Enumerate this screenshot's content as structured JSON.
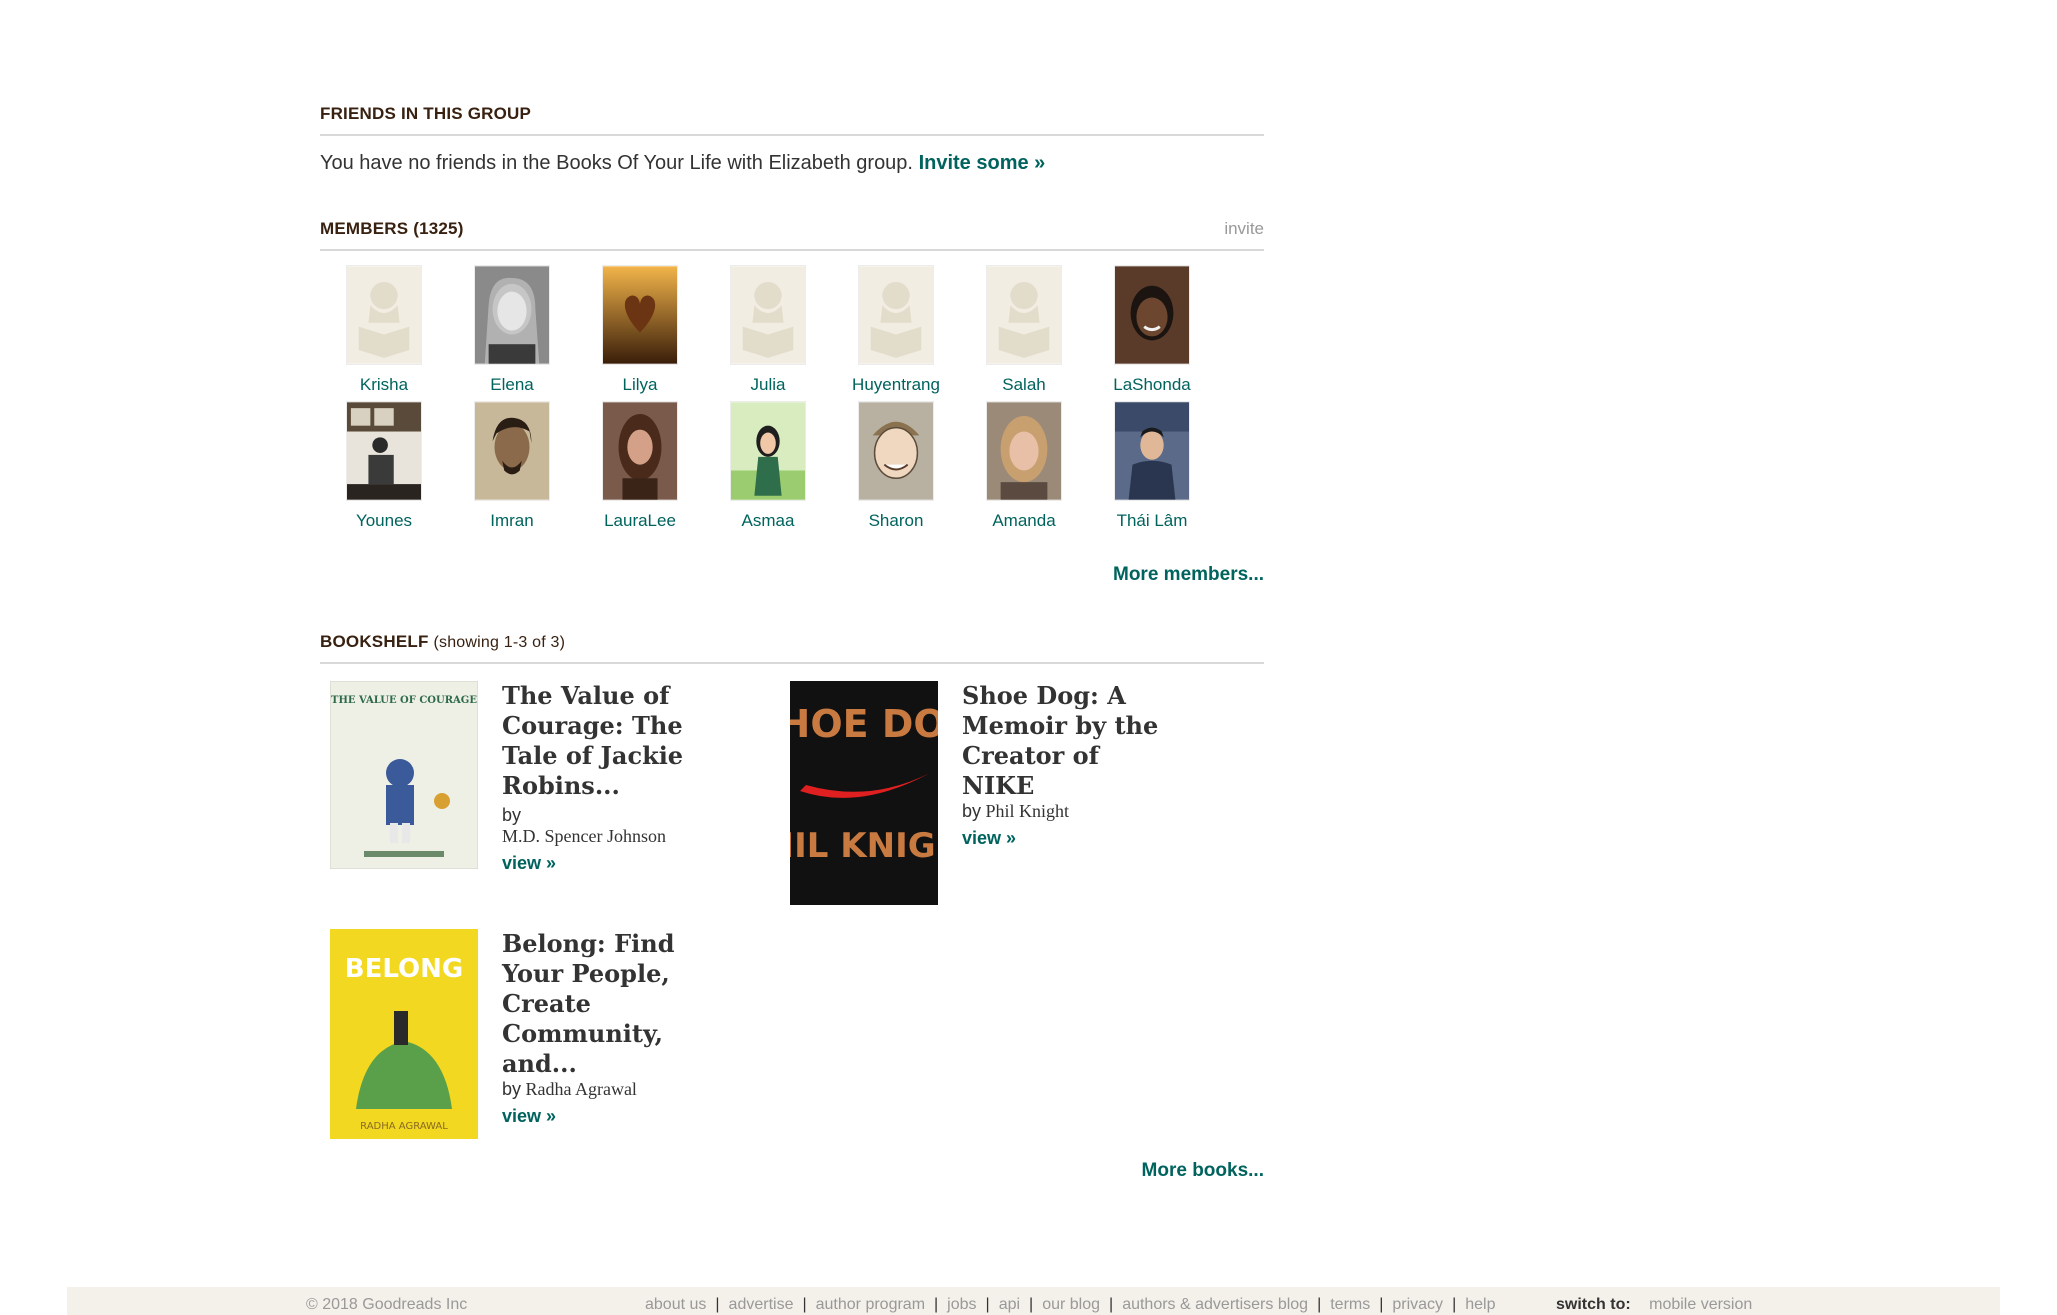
{
  "friends": {
    "title": "FRIENDS IN THIS GROUP",
    "text": "You have no friends in the Books Of Your Life with Elizabeth group.",
    "invite_link": "Invite some »"
  },
  "members": {
    "title": "MEMBERS (1325)",
    "invite": "invite",
    "list": [
      {
        "name": "Krisha"
      },
      {
        "name": "Elena"
      },
      {
        "name": "Lilya"
      },
      {
        "name": "Julia"
      },
      {
        "name": "Huyentrang"
      },
      {
        "name": "Salah"
      },
      {
        "name": "LaShonda"
      },
      {
        "name": "Younes"
      },
      {
        "name": "Imran"
      },
      {
        "name": "LauraLee"
      },
      {
        "name": "Asmaa"
      },
      {
        "name": "Sharon"
      },
      {
        "name": "Amanda"
      },
      {
        "name": "Thái Lâm"
      }
    ],
    "more": "More members..."
  },
  "bookshelf": {
    "title": "BOOKSHELF",
    "subtitle": "(showing 1-3 of 3)",
    "books": [
      {
        "title": "The Value of Courage: The Tale of Jackie Robins...",
        "by": "by",
        "author": "M.D. Spencer Johnson",
        "view": "view »",
        "cover_text": "THE VALUE OF COURAGE"
      },
      {
        "title": "Shoe Dog: A Memoir by the Creator of NIKE",
        "by": "by",
        "author": "Phil Knight",
        "view": "view »",
        "cover_text_1": "SHOE DOG",
        "cover_text_2": "PHIL KNIGHT"
      },
      {
        "title": "Belong: Find Your People, Create Community, and...",
        "by": "by",
        "author": "Radha Agrawal",
        "view": "view »",
        "cover_text": "BELONG",
        "cover_author": "RADHA AGRAWAL"
      }
    ],
    "more": "More books..."
  },
  "footer": {
    "copyright": "© 2018 Goodreads Inc",
    "links": [
      "about us",
      "advertise",
      "author program",
      "jobs",
      "api",
      "our blog",
      "authors & advertisers blog",
      "terms",
      "privacy",
      "help"
    ],
    "switch_label": "switch to:",
    "switch_link": "mobile version"
  },
  "colors": {
    "link": "#00635d",
    "heading": "#382110",
    "footer_bg": "#f4f1ea"
  }
}
